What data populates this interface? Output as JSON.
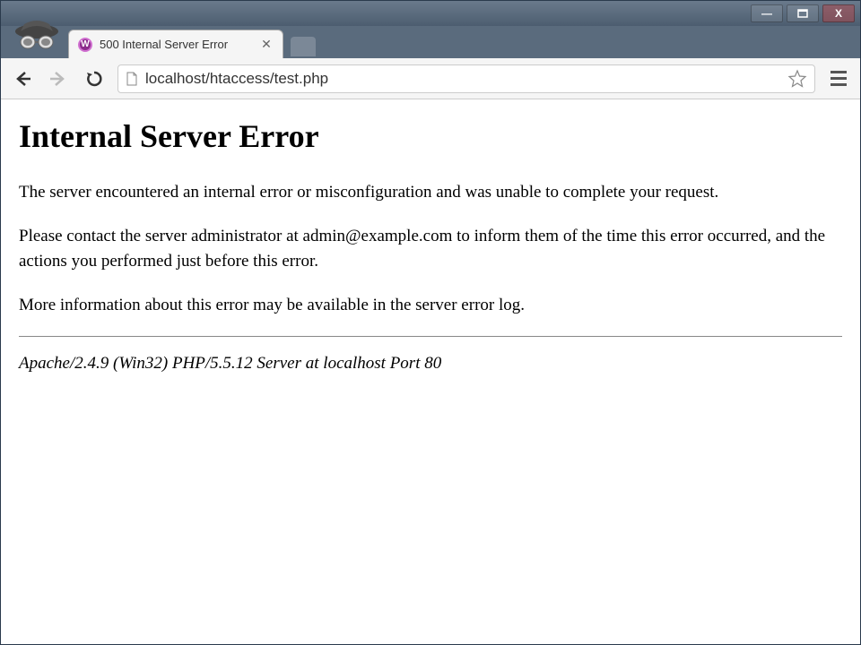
{
  "window": {
    "minimize": "—",
    "maximize": "□",
    "close": "X"
  },
  "tab": {
    "title": "500 Internal Server Error",
    "favicon_letter": "W"
  },
  "toolbar": {
    "url": "localhost/htaccess/test.php"
  },
  "page": {
    "heading": "Internal Server Error",
    "paragraph1": "The server encountered an internal error or misconfiguration and was unable to complete your request.",
    "paragraph2": "Please contact the server administrator at admin@example.com to inform them of the time this error occurred, and the actions you performed just before this error.",
    "paragraph3": "More information about this error may be available in the server error log.",
    "server_signature": "Apache/2.4.9 (Win32) PHP/5.5.12 Server at localhost Port 80"
  }
}
